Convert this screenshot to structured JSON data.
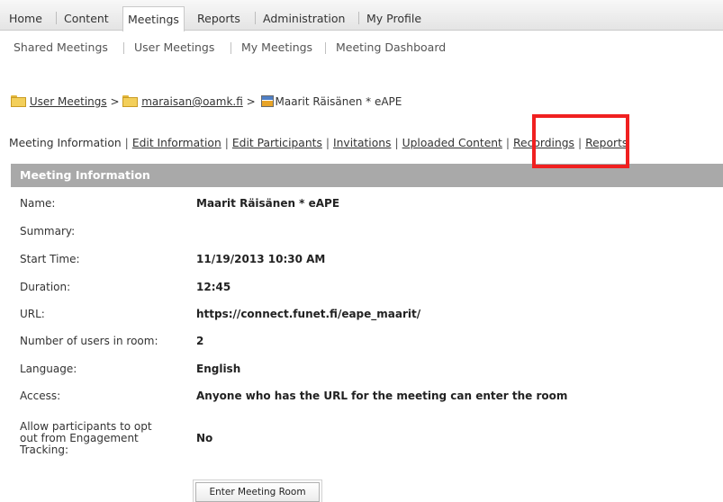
{
  "top_nav": {
    "items": [
      "Home",
      "Content",
      "Meetings",
      "Reports",
      "Administration",
      "My Profile"
    ]
  },
  "sub_nav": {
    "items": [
      "Shared Meetings",
      "User Meetings",
      "My Meetings",
      "Meeting Dashboard"
    ]
  },
  "breadcrumb": {
    "root": "User Meetings",
    "user": "maraisan@oamk.fi",
    "meeting": "Maarit Räisänen * eAPE",
    "separator": ">"
  },
  "tabs": {
    "items": [
      "Meeting Information",
      "Edit Information",
      "Edit Participants",
      "Invitations",
      "Uploaded Content",
      "Recordings",
      "Reports"
    ],
    "separator": "|"
  },
  "panel": {
    "title": "Meeting Information"
  },
  "info": {
    "name_label": "Name:",
    "name_value": "Maarit Räisänen * eAPE",
    "summary_label": "Summary:",
    "summary_value": "",
    "start_label": "Start Time:",
    "start_value": "11/19/2013 10:30 AM",
    "duration_label": "Duration:",
    "duration_value": "12:45",
    "url_label": "URL:",
    "url_value": "https://connect.funet.fi/eape_maarit/",
    "users_label": "Number of users in room:",
    "users_value": "2",
    "language_label": "Language:",
    "language_value": "English",
    "access_label": "Access:",
    "access_value": "Anyone who has the URL for the meeting can enter the room",
    "optout_label_1": "Allow participants to opt",
    "optout_label_2": "out from Engagement",
    "optout_label_3": "Tracking:",
    "optout_value": "No"
  },
  "buttons": {
    "enter_room": "Enter Meeting Room"
  },
  "colors": {
    "panel_header": "#a9a9a9",
    "highlight": "#f02020"
  }
}
